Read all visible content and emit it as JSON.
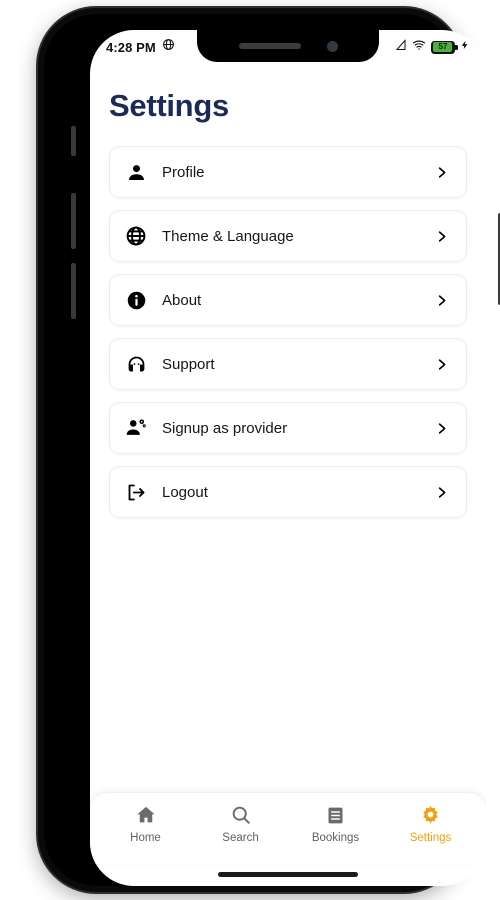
{
  "status_bar": {
    "time": "4:28 PM",
    "browser_icon": "globe-icon",
    "signal_icon": "cellular-signal-icon",
    "wifi_icon": "wifi-icon",
    "battery_level": "57",
    "battery_icon": "battery-icon",
    "charging_icon": "charging-bolt-icon"
  },
  "header": {
    "title": "Settings",
    "title_color": "#1b2a57"
  },
  "settings": {
    "items": [
      {
        "label": "Profile",
        "icon": "person-icon",
        "chevron": "chevron-right-icon"
      },
      {
        "label": "Theme & Language",
        "icon": "globe-icon",
        "chevron": "chevron-right-icon"
      },
      {
        "label": "About",
        "icon": "info-circle-icon",
        "chevron": "chevron-right-icon"
      },
      {
        "label": "Support",
        "icon": "headset-icon",
        "chevron": "chevron-right-icon"
      },
      {
        "label": "Signup as provider",
        "icon": "person-gear-icon",
        "chevron": "chevron-right-icon"
      },
      {
        "label": "Logout",
        "icon": "logout-arrow-icon",
        "chevron": "chevron-right-icon"
      }
    ]
  },
  "bottom_nav": {
    "active_color": "#f2a00d",
    "inactive_color": "#5f5f5f",
    "items": [
      {
        "label": "Home",
        "icon": "home-icon",
        "active": false
      },
      {
        "label": "Search",
        "icon": "search-icon",
        "active": false
      },
      {
        "label": "Bookings",
        "icon": "bookings-icon",
        "active": false
      },
      {
        "label": "Settings",
        "icon": "gear-icon",
        "active": true
      }
    ]
  }
}
